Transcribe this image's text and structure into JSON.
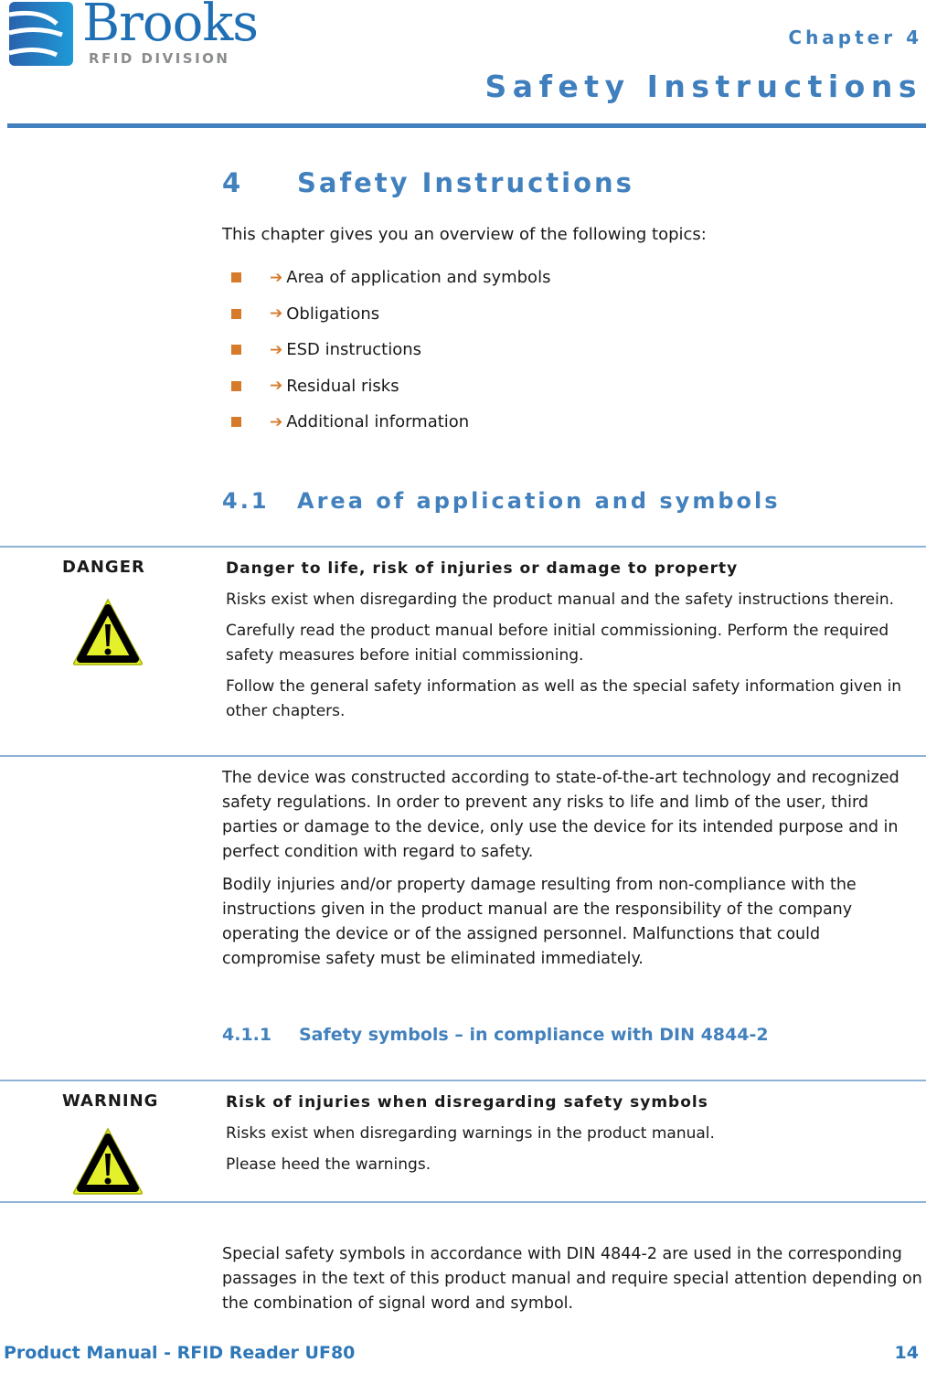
{
  "header": {
    "logo": {
      "brand": "Brooks",
      "division": "RFID DIVISION"
    },
    "chapter_label": "Chapter 4",
    "chapter_title": "Safety Instructions"
  },
  "section": {
    "number": "4",
    "title": "Safety Instructions",
    "intro": "This chapter gives you an overview of the following topics:",
    "topics": [
      {
        "label": "Area of application and symbols"
      },
      {
        "label": "Obligations"
      },
      {
        "label": "ESD instructions"
      },
      {
        "label": "Residual risks"
      },
      {
        "label": "Additional information"
      }
    ],
    "arrow_glyph": "➔"
  },
  "subsection": {
    "number": "4.1",
    "title": "Area of application and symbols",
    "danger_notice": {
      "signal_word": "DANGER",
      "icon": "warning-triangle-icon",
      "title": "Danger to life, risk of injuries or damage to property",
      "paragraphs": [
        "Risks exist when disregarding the product manual and the safety instructions therein.",
        "Carefully read the product manual before initial commissioning. Perform the required safety measures before initial commissioning.",
        "Follow the general safety information as well as the special safety information given in other chapters."
      ]
    },
    "paragraphs": [
      "The device was constructed according to state-of-the-art technology and recognized safety regulations. In order to prevent any risks to life and limb of the user, third parties or damage to the device, only use the device for its intended purpose and in perfect condition with regard to safety.",
      "Bodily injuries and/or property damage resulting from non-compliance with the instructions given in the product manual are the responsibility of the company operating the device or of the assigned personnel. Malfunctions that could compromise safety must be eliminated immediately."
    ]
  },
  "subsubsection": {
    "number": "4.1.1",
    "title": "Safety symbols – in compliance with DIN 4844-2",
    "warning_notice": {
      "signal_word": "WARNING",
      "icon": "warning-triangle-icon",
      "title": "Risk of injuries when disregarding safety symbols",
      "paragraphs": [
        "Risks exist when disregarding warnings in the product manual.",
        "Please heed the warnings."
      ]
    },
    "paragraphs": [
      "Special safety symbols in accordance with DIN 4844-2 are used in the corresponding passages in the text of this product manual and require special attention depending on the combination of signal word and symbol."
    ]
  },
  "footer": {
    "title": "Product Manual - RFID Reader UF80",
    "page_number": "14"
  },
  "colors": {
    "accent_blue": "#4281bd",
    "bullet_orange": "#d67a2b",
    "rule_light_blue": "#8eb3d6",
    "warning_yellow": "#e4f02a"
  }
}
